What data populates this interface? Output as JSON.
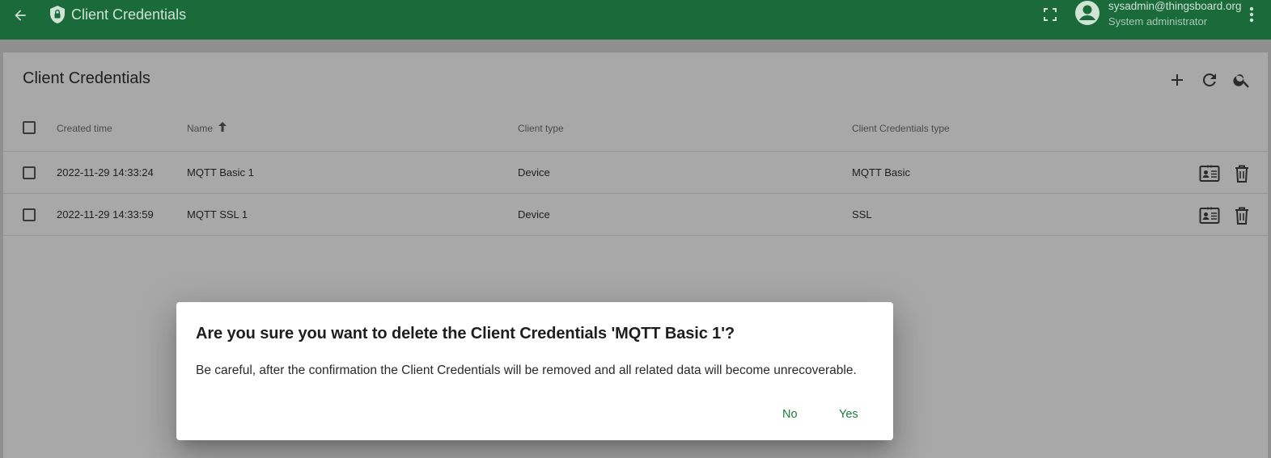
{
  "header": {
    "title": "Client Credentials",
    "user_email": "sysadmin@thingsboard.org",
    "user_role": "System administrator"
  },
  "panel": {
    "title": "Client Credentials",
    "columns": [
      "Created time",
      "Name",
      "Client type",
      "Client Credentials type"
    ],
    "rows": [
      {
        "created": "2022-11-29 14:33:24",
        "name": "MQTT Basic 1",
        "client_type": "Device",
        "cred_type": "MQTT Basic"
      },
      {
        "created": "2022-11-29 14:33:59",
        "name": "MQTT SSL 1",
        "client_type": "Device",
        "cred_type": "SSL"
      }
    ]
  },
  "dialog": {
    "title": "Are you sure you want to delete the Client Credentials 'MQTT Basic 1'?",
    "message": "Be careful, after the confirmation the Client Credentials will be removed and all related data will become unrecoverable.",
    "no_label": "No",
    "yes_label": "Yes"
  },
  "colors": {
    "toolbar": "#1a6a3a",
    "accent": "#1a7d3e",
    "overlay": "#8f8f8f"
  }
}
